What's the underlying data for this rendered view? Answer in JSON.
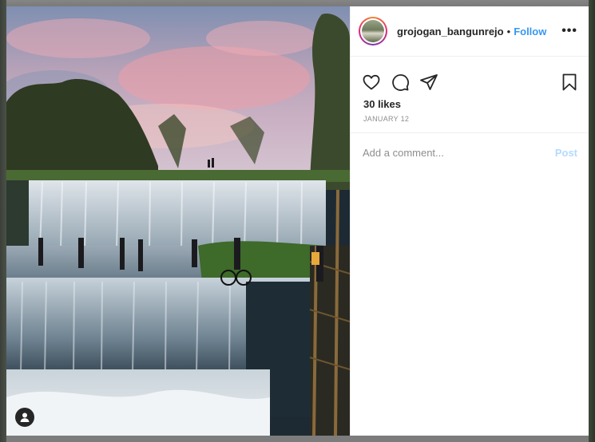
{
  "post": {
    "username": "grojogan_bangunrejo",
    "separator": "•",
    "follow_label": "Follow",
    "more_label": "•••",
    "likes": "30 likes",
    "date": "JANUARY 12",
    "comment_placeholder": "Add a comment...",
    "post_label": "Post"
  },
  "icons": {
    "like": "heart-icon",
    "comment": "comment-icon",
    "share": "paper-plane-icon",
    "save": "bookmark-icon",
    "user_tag": "user-icon"
  },
  "colors": {
    "follow": "#3897f0",
    "post_disabled": "#b3dbff",
    "muted_text": "#8e8e8e"
  }
}
